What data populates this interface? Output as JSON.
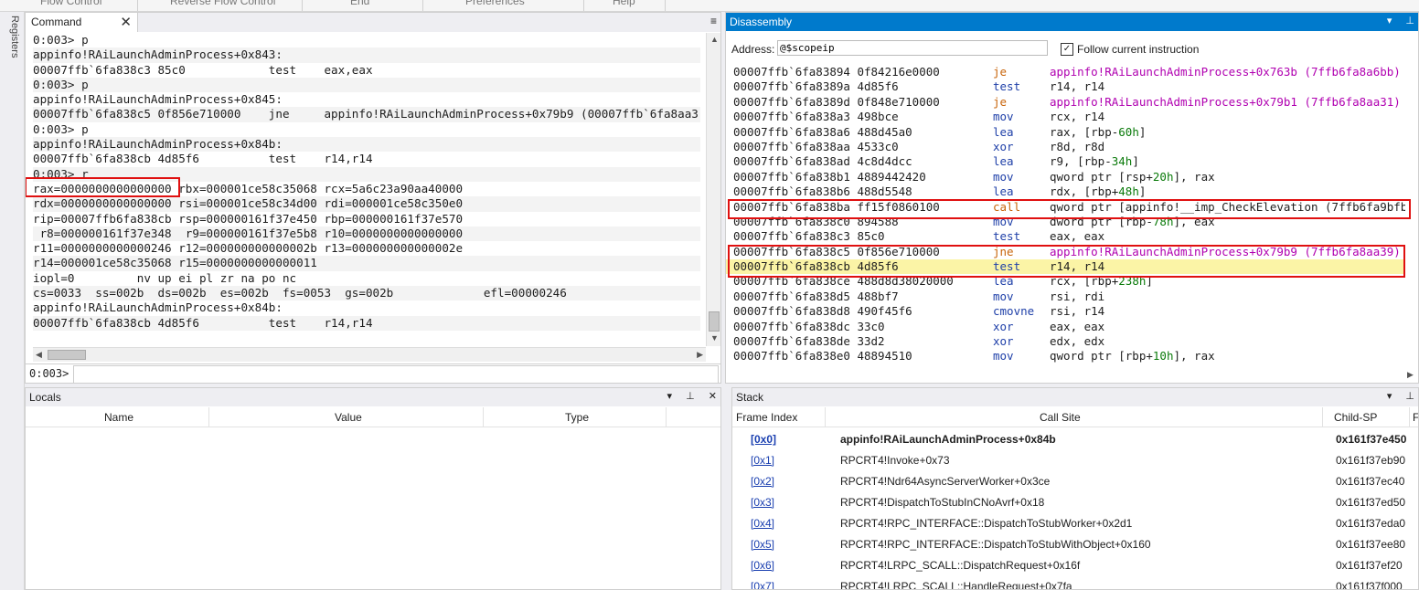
{
  "menu": [
    "Flow Control",
    "Reverse Flow Control",
    "End",
    "Preferences",
    "Help"
  ],
  "side_tab": "Registers",
  "command": {
    "tab_label": "Command",
    "close_glyph": "✕",
    "lines": [
      "0:003> p",
      "appinfo!RAiLaunchAdminProcess+0x843:",
      "00007ffb`6fa838c3 85c0            test    eax,eax",
      "0:003> p",
      "appinfo!RAiLaunchAdminProcess+0x845:",
      "00007ffb`6fa838c5 0f856e710000    jne     appinfo!RAiLaunchAdminProcess+0x79b9 (00007ffb`6fa8aa3",
      "0:003> p",
      "appinfo!RAiLaunchAdminProcess+0x84b:",
      "00007ffb`6fa838cb 4d85f6          test    r14,r14",
      "0:003> r",
      "rax=0000000000000000 rbx=000001ce58c35068 rcx=5a6c23a90aa40000",
      "rdx=0000000000000000 rsi=000001ce58c34d00 rdi=000001ce58c350e0",
      "rip=00007ffb6fa838cb rsp=000000161f37e450 rbp=000000161f37e570",
      " r8=000000161f37e348  r9=000000161f37e5b8 r10=0000000000000000",
      "r11=0000000000000246 r12=000000000000002b r13=000000000000002e",
      "r14=000001ce58c35068 r15=0000000000000011",
      "iopl=0         nv up ei pl zr na po nc",
      "cs=0033  ss=002b  ds=002b  es=002b  fs=0053  gs=002b             efl=00000246",
      "appinfo!RAiLaunchAdminProcess+0x84b:",
      "00007ffb`6fa838cb 4d85f6          test    r14,r14"
    ],
    "prompt": "0:003>",
    "input_value": ""
  },
  "disassembly": {
    "title": "Disassembly",
    "address_label": "Address:",
    "address_value": "@$scopeip",
    "follow_label": "Follow current instruction",
    "follow_checked": "✓",
    "rows": [
      {
        "addr": "00007ffb`6fa83894 0f84216e0000",
        "op": "je",
        "kind": "jump",
        "args": [
          {
            "t": "appinfo!RAiLaunchAdminProcess+0x763b (7ffb6fa8a6bb)",
            "c": "sym"
          }
        ]
      },
      {
        "addr": "00007ffb`6fa8389a 4d85f6",
        "op": "test",
        "kind": "norm",
        "args": [
          {
            "t": "r14, r14",
            "c": "plain"
          }
        ]
      },
      {
        "addr": "00007ffb`6fa8389d 0f848e710000",
        "op": "je",
        "kind": "jump",
        "args": [
          {
            "t": "appinfo!RAiLaunchAdminProcess+0x79b1 (7ffb6fa8aa31)",
            "c": "sym"
          }
        ]
      },
      {
        "addr": "00007ffb`6fa838a3 498bce",
        "op": "mov",
        "kind": "norm",
        "args": [
          {
            "t": "rcx, r14",
            "c": "plain"
          }
        ]
      },
      {
        "addr": "00007ffb`6fa838a6 488d45a0",
        "op": "lea",
        "kind": "norm",
        "args": [
          {
            "t": "rax, [rbp-",
            "c": "plain"
          },
          {
            "t": "60h",
            "c": "hex"
          },
          {
            "t": "]",
            "c": "plain"
          }
        ]
      },
      {
        "addr": "00007ffb`6fa838aa 4533c0",
        "op": "xor",
        "kind": "norm",
        "args": [
          {
            "t": "r8d, r8d",
            "c": "plain"
          }
        ]
      },
      {
        "addr": "00007ffb`6fa838ad 4c8d4dcc",
        "op": "lea",
        "kind": "norm",
        "args": [
          {
            "t": "r9, [rbp-",
            "c": "plain"
          },
          {
            "t": "34h",
            "c": "hex"
          },
          {
            "t": "]",
            "c": "plain"
          }
        ]
      },
      {
        "addr": "00007ffb`6fa838b1 4889442420",
        "op": "mov",
        "kind": "norm",
        "args": [
          {
            "t": "qword ptr [rsp+",
            "c": "plain"
          },
          {
            "t": "20h",
            "c": "hex"
          },
          {
            "t": "], rax",
            "c": "plain"
          }
        ]
      },
      {
        "addr": "00007ffb`6fa838b6 488d5548",
        "op": "lea",
        "kind": "norm",
        "args": [
          {
            "t": "rdx, [rbp+",
            "c": "plain"
          },
          {
            "t": "48h",
            "c": "hex"
          },
          {
            "t": "]",
            "c": "plain"
          }
        ]
      },
      {
        "addr": "00007ffb`6fa838ba ff15f0860100",
        "op": "call",
        "kind": "jump",
        "args": [
          {
            "t": "qword ptr [appinfo!__imp_CheckElevation (7ffb6fa9bfb0)]",
            "c": "plain"
          }
        ]
      },
      {
        "addr": "00007ffb`6fa838c0 894588",
        "op": "mov",
        "kind": "norm",
        "args": [
          {
            "t": "dword ptr [rbp-",
            "c": "plain"
          },
          {
            "t": "78h",
            "c": "hex"
          },
          {
            "t": "], eax",
            "c": "plain"
          }
        ]
      },
      {
        "addr": "00007ffb`6fa838c3 85c0",
        "op": "test",
        "kind": "norm",
        "args": [
          {
            "t": "eax, eax",
            "c": "plain"
          }
        ]
      },
      {
        "addr": "00007ffb`6fa838c5 0f856e710000",
        "op": "jne",
        "kind": "jump",
        "args": [
          {
            "t": "appinfo!RAiLaunchAdminProcess+0x79b9 (7ffb6fa8aa39)",
            "c": "sym"
          }
        ]
      },
      {
        "addr": "00007ffb`6fa838cb 4d85f6",
        "op": "test",
        "kind": "norm",
        "current": true,
        "args": [
          {
            "t": "r14, r14",
            "c": "plain"
          }
        ]
      },
      {
        "addr": "00007ffb`6fa838ce 488d8d38020000",
        "op": "lea",
        "kind": "norm",
        "args": [
          {
            "t": "rcx, [rbp+",
            "c": "plain"
          },
          {
            "t": "238h",
            "c": "hex"
          },
          {
            "t": "]",
            "c": "plain"
          }
        ]
      },
      {
        "addr": "00007ffb`6fa838d5 488bf7",
        "op": "mov",
        "kind": "norm",
        "args": [
          {
            "t": "rsi, rdi",
            "c": "plain"
          }
        ]
      },
      {
        "addr": "00007ffb`6fa838d8 490f45f6",
        "op": "cmovne",
        "kind": "norm",
        "args": [
          {
            "t": "rsi, r14",
            "c": "plain"
          }
        ]
      },
      {
        "addr": "00007ffb`6fa838dc 33c0",
        "op": "xor",
        "kind": "norm",
        "args": [
          {
            "t": "eax, eax",
            "c": "plain"
          }
        ]
      },
      {
        "addr": "00007ffb`6fa838de 33d2",
        "op": "xor",
        "kind": "norm",
        "args": [
          {
            "t": "edx, edx",
            "c": "plain"
          }
        ]
      },
      {
        "addr": "00007ffb`6fa838e0 48894510",
        "op": "mov",
        "kind": "norm",
        "args": [
          {
            "t": "qword ptr [rbp+",
            "c": "plain"
          },
          {
            "t": "10h",
            "c": "hex"
          },
          {
            "t": "], rax",
            "c": "plain"
          }
        ]
      }
    ]
  },
  "locals": {
    "title": "Locals",
    "columns": [
      "Name",
      "Value",
      "Type"
    ]
  },
  "stack": {
    "title": "Stack",
    "columns": [
      "Frame Index",
      "Call Site",
      "Child-SP",
      "F"
    ],
    "rows": [
      {
        "idx": "[0x0]",
        "site": "appinfo!RAiLaunchAdminProcess+0x84b",
        "sp": "0x161f37e450",
        "bold": true
      },
      {
        "idx": "[0x1]",
        "site": "RPCRT4!Invoke+0x73",
        "sp": "0x161f37eb90"
      },
      {
        "idx": "[0x2]",
        "site": "RPCRT4!Ndr64AsyncServerWorker+0x3ce",
        "sp": "0x161f37ec40"
      },
      {
        "idx": "[0x3]",
        "site": "RPCRT4!DispatchToStubInCNoAvrf+0x18",
        "sp": "0x161f37ed50"
      },
      {
        "idx": "[0x4]",
        "site": "RPCRT4!RPC_INTERFACE::DispatchToStubWorker+0x2d1",
        "sp": "0x161f37eda0"
      },
      {
        "idx": "[0x5]",
        "site": "RPCRT4!RPC_INTERFACE::DispatchToStubWithObject+0x160",
        "sp": "0x161f37ee80"
      },
      {
        "idx": "[0x6]",
        "site": "RPCRT4!LRPC_SCALL::DispatchRequest+0x16f",
        "sp": "0x161f37ef20"
      },
      {
        "idx": "[0x7]",
        "site": "RPCRT4!LRPC_SCALL::HandleRequest+0x7fa",
        "sp": "0x161f37f000"
      }
    ]
  },
  "icons": {
    "dropdown": "▾",
    "pin": "⊥",
    "close": "✕",
    "menu": "≡"
  },
  "colors": {
    "accent": "#007acc",
    "highlight": "#fbf4a6",
    "annotation": "#e01010",
    "jump": "#c8640a",
    "symbol": "#b000b0"
  }
}
